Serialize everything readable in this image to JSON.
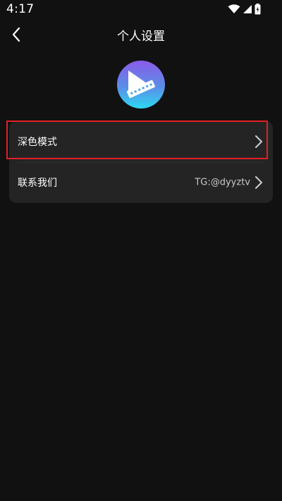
{
  "status_bar": {
    "time": "4:17",
    "icons": [
      "wifi-icon",
      "signal-icon",
      "battery-icon"
    ]
  },
  "header": {
    "title": "个人设置",
    "back_icon": "chevron-left-icon"
  },
  "logo": {
    "icon": "app-logo-icon",
    "gradient_colors": [
      "#7b5be8",
      "#2fd4f0"
    ]
  },
  "settings": {
    "items": [
      {
        "label": "深色模式",
        "value": "",
        "icon": "chevron-right-icon"
      },
      {
        "label": "联系我们",
        "value": "TG:@dyyztv",
        "icon": "chevron-right-icon"
      }
    ]
  },
  "colors": {
    "background": "#111111",
    "card": "#242424",
    "highlight": "#e31f25"
  }
}
